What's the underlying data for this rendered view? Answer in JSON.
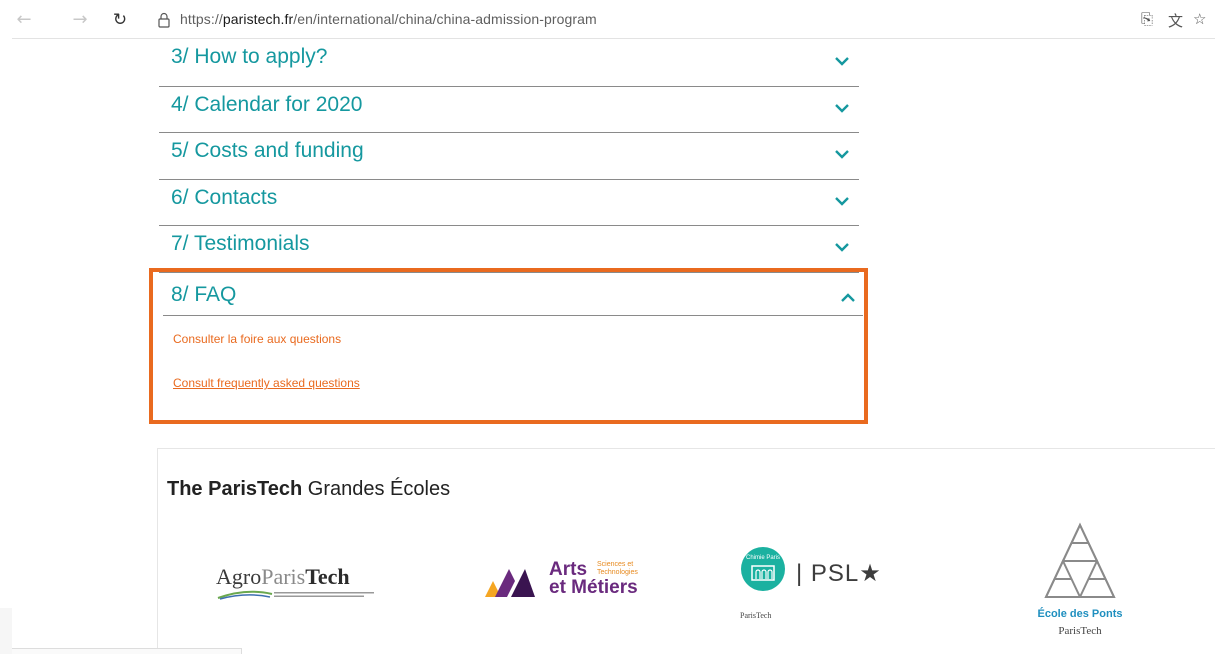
{
  "browser": {
    "url_prefix": "https://",
    "url_host": "paristech.fr",
    "url_path": "/en/international/china/china-admission-program"
  },
  "accordion": {
    "items": [
      {
        "label": "3/ How to apply?"
      },
      {
        "label": "4/ Calendar for 2020"
      },
      {
        "label": "5/ Costs and funding"
      },
      {
        "label": "6/ Contacts"
      },
      {
        "label": "7/ Testimonials"
      }
    ],
    "faq": {
      "label": "8/ FAQ",
      "line1": "Consulter la foire aux questions",
      "line2": "Consult frequently asked questions"
    }
  },
  "schools": {
    "title_bold": "The ParisTech",
    "title_rest": " Grandes Écoles",
    "agro": {
      "a": "A",
      "gro": "gro",
      "paris": "Paris",
      "tech": "Tech"
    },
    "am": {
      "arts": "Arts",
      "sciences": "Sciences et",
      "technologies": "Technologies",
      "metiers": "et Métiers"
    },
    "chimie": {
      "top": "Chimie Paris",
      "bottom": "ParisTech",
      "psl": "| PSL★"
    },
    "ponts": {
      "name": "École des Ponts",
      "sub": "ParisTech"
    }
  },
  "colors": {
    "teal": "#15989f",
    "orange": "#e96a1f"
  }
}
